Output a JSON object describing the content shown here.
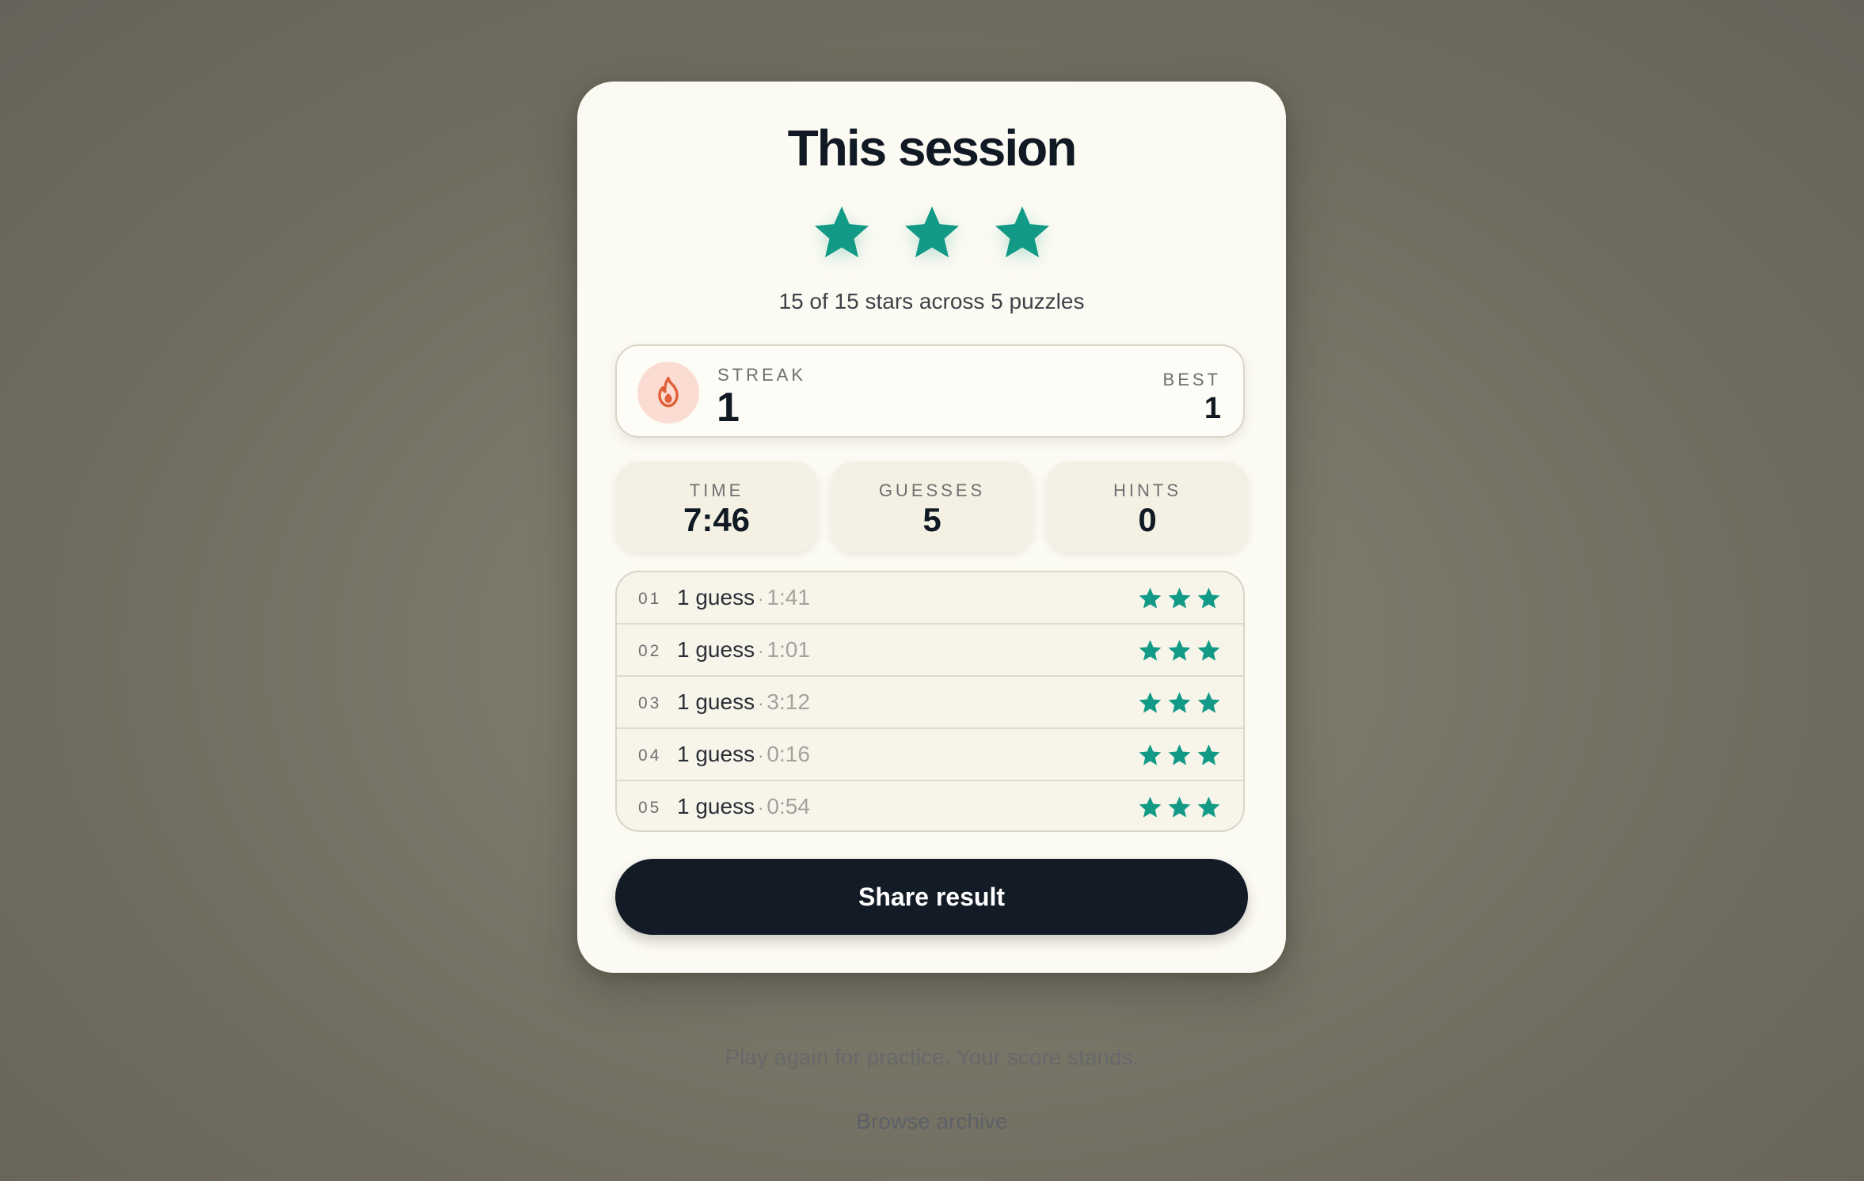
{
  "card": {
    "title": "This session",
    "stars_earned": 3,
    "stars_total": 3,
    "summary": "15 of 15 stars across 5 puzzles"
  },
  "streak": {
    "label": "STREAK",
    "value": "1",
    "best_label": "BEST",
    "best_value": "1",
    "icon": "flame-icon"
  },
  "stats": [
    {
      "label": "TIME",
      "value": "7:46"
    },
    {
      "label": "GUESSES",
      "value": "5"
    },
    {
      "label": "HINTS",
      "value": "0"
    }
  ],
  "puzzles": [
    {
      "num": "01",
      "guesses": "1 guess",
      "sep": "·",
      "time": "1:41",
      "stars": 3
    },
    {
      "num": "02",
      "guesses": "1 guess",
      "sep": "·",
      "time": "1:01",
      "stars": 3
    },
    {
      "num": "03",
      "guesses": "1 guess",
      "sep": "·",
      "time": "3:12",
      "stars": 3
    },
    {
      "num": "04",
      "guesses": "1 guess",
      "sep": "·",
      "time": "0:16",
      "stars": 3
    },
    {
      "num": "05",
      "guesses": "1 guess",
      "sep": "·",
      "time": "0:54",
      "stars": 3
    }
  ],
  "share_label": "Share result",
  "footer": {
    "note": "Play again for practice. Your score stands.",
    "link": "Browse archive"
  },
  "colors": {
    "accent_star": "#129a86",
    "button": "#131c26",
    "flame": "#e0603a"
  }
}
